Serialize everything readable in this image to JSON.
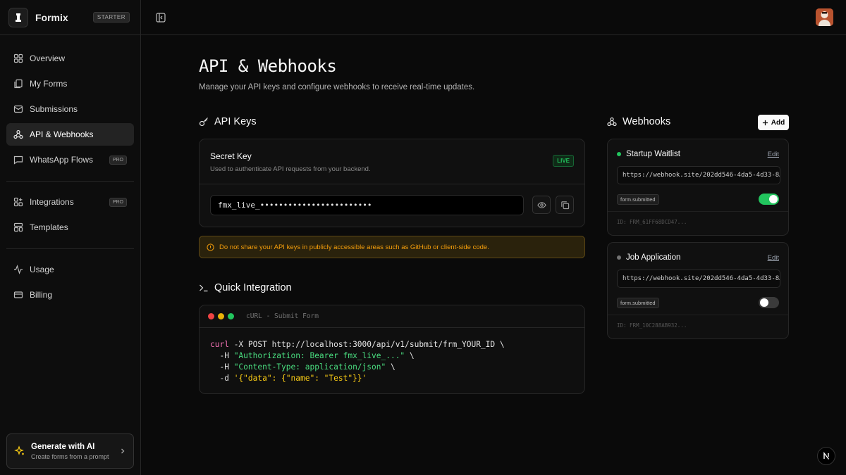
{
  "app": {
    "name": "Formix",
    "plan": "STARTER"
  },
  "sidebar": {
    "items": [
      {
        "label": "Overview",
        "icon": "grid-icon"
      },
      {
        "label": "My Forms",
        "icon": "forms-icon"
      },
      {
        "label": "Submissions",
        "icon": "inbox-icon"
      },
      {
        "label": "API & Webhooks",
        "icon": "webhook-icon",
        "active": true
      },
      {
        "label": "WhatsApp Flows",
        "icon": "chat-icon",
        "badge": "PRO"
      }
    ],
    "items2": [
      {
        "label": "Integrations",
        "icon": "puzzle-icon",
        "badge": "PRO"
      },
      {
        "label": "Templates",
        "icon": "template-icon"
      }
    ],
    "items3": [
      {
        "label": "Usage",
        "icon": "activity-icon"
      },
      {
        "label": "Billing",
        "icon": "card-icon"
      }
    ],
    "generate": {
      "title": "Generate with AI",
      "subtitle": "Create forms from a prompt"
    }
  },
  "page": {
    "title": "API & Webhooks",
    "subtitle": "Manage your API keys and configure webhooks to receive real-time updates."
  },
  "api_keys": {
    "heading": "API Keys",
    "secret_title": "Secret Key",
    "secret_desc": "Used to authenticate API requests from your backend.",
    "status": "LIVE",
    "key_masked": "fmx_live_••••••••••••••••••••••••",
    "warning": "Do not share your API keys in publicly accessible areas such as GitHub or client-side code."
  },
  "integration": {
    "heading": "Quick Integration",
    "tab_label": "cURL - Submit Form",
    "code": {
      "l1a": "curl",
      "l1b": " -X POST http://localhost:3000/api/v1/submit/frm_YOUR_ID \\",
      "l2a": "  -H ",
      "l2b": "\"Authorization: Bearer fmx_live_...\"",
      "l2c": " \\",
      "l3a": "  -H ",
      "l3b": "\"Content-Type: application/json\"",
      "l3c": " \\",
      "l4a": "  -d ",
      "l4b": "'{\"data\": {\"name\": \"Test\"}}'"
    }
  },
  "webhooks": {
    "heading": "Webhooks",
    "add_label": "Add",
    "items": [
      {
        "name": "Startup Waitlist",
        "edit": "Edit",
        "url": "https://webhook.site/202dd546-4da5-4d33-8…",
        "event": "form.submitted",
        "enabled": true,
        "id": "ID: FRM_61FF68DCD47..."
      },
      {
        "name": "Job Application",
        "edit": "Edit",
        "url": "https://webhook.site/202dd546-4da5-4d33-8…",
        "event": "form.submitted",
        "enabled": false,
        "id": "ID: FRM_10C288AB932..."
      }
    ]
  },
  "colors": {
    "accent_green": "#22c55e",
    "warning": "#f59e0b"
  }
}
